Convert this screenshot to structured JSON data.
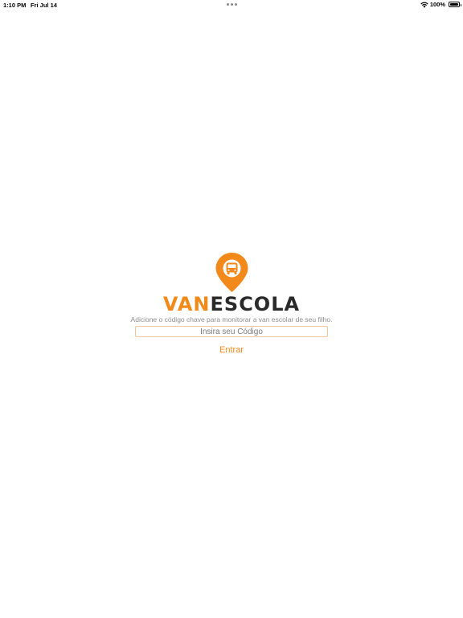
{
  "status_bar": {
    "time": "1:10 PM",
    "date": "Fri Jul 14",
    "battery_percent": "100%",
    "icons": [
      "wifi-icon",
      "battery-icon"
    ]
  },
  "logo": {
    "text_part1": "VAN",
    "text_part2": "ESCOLA",
    "icon": "location-pin-bus-icon",
    "colors": {
      "accent": "#f28a1b",
      "dark": "#2a2a2a"
    }
  },
  "form": {
    "subtitle": "Adicione o código chave para monitorar a van escolar de seu filho.",
    "code_placeholder": "Insira seu Código",
    "code_value": "",
    "submit_label": "Entrar"
  }
}
